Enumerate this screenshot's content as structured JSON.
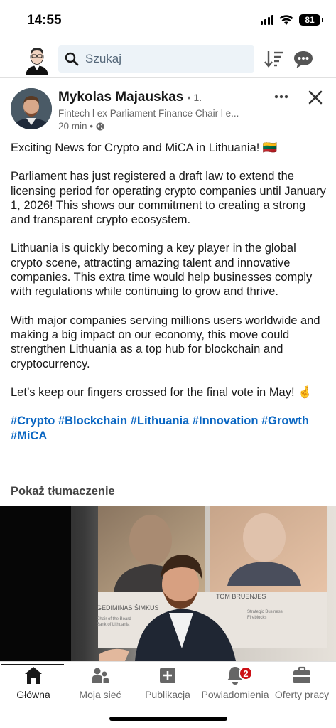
{
  "status_bar": {
    "time": "14:55",
    "battery": "81"
  },
  "search": {
    "placeholder": "Szukaj"
  },
  "post": {
    "author_name": "Mykolas Majauskas",
    "degree": "• 1.",
    "headline": "Fintech l ex Parliament Finance Chair l e...",
    "time_ago": "20 min •",
    "paragraphs": [
      "Exciting News for Crypto and MiCA in Lithuania! 🇱🇹",
      "Parliament has just registered a draft law to extend the licensing period for operating crypto companies until January 1, 2026! This shows our commitment to creating a strong and transparent crypto ecosystem.",
      "Lithuania is quickly becoming a key player in the global crypto scene, attracting amazing talent and innovative companies. This extra time would help businesses comply with regulations while continuing to grow and thrive.",
      "With major companies serving millions users worldwide and making a big impact on our economy, this move could strengthen Lithuania as a top hub for blockchain and cryptocurrency.",
      "Let’s keep our fingers crossed for the final vote in May! 🤞"
    ],
    "hashtags": "#Crypto #Blockchain #Lithuania #Innovation #Growth #MiCA",
    "translate_label": "Pokaż tłumaczenie",
    "photo_text": {
      "speaker1_name": "GEDIMINAS ŠIMKUS",
      "speaker1_role1": "Chair of the Board",
      "speaker1_role2": "Bank of Lithuania",
      "speaker2_name": "TOM BRUENJES",
      "speaker2_role1": "Strategic Business",
      "speaker2_role2": "Fireblocks"
    }
  },
  "tabs": [
    {
      "label": "Główna",
      "icon": "home-icon",
      "active": true
    },
    {
      "label": "Moja sieć",
      "icon": "network-icon"
    },
    {
      "label": "Publikacja",
      "icon": "post-icon"
    },
    {
      "label": "Powiadomienia",
      "icon": "bell-icon",
      "badge": "2"
    },
    {
      "label": "Oferty pracy",
      "icon": "briefcase-icon"
    }
  ],
  "colors": {
    "accent": "#0a66c2",
    "badge": "#cc1016",
    "search_bg": "#edf3f8"
  }
}
